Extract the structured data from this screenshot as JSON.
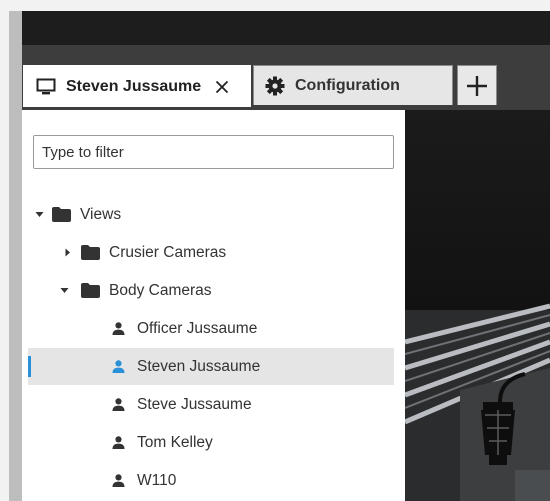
{
  "tabs": [
    {
      "label": "Steven Jussaume",
      "icon": "monitor-icon",
      "active": true,
      "closable": true
    },
    {
      "label": "Configuration",
      "icon": "gear-icon",
      "active": false
    }
  ],
  "add_tab_icon": "plus-icon",
  "filter": {
    "placeholder": "Type to filter",
    "value": ""
  },
  "tree": {
    "root": {
      "label": "Views",
      "expanded": true
    },
    "groups": [
      {
        "label": "Crusier Cameras",
        "expanded": false
      },
      {
        "label": "Body Cameras",
        "expanded": true
      }
    ],
    "cameras": [
      {
        "label": "Officer Jussaume",
        "selected": false
      },
      {
        "label": "Steven Jussaume",
        "selected": true
      },
      {
        "label": "Steve Jussaume",
        "selected": false
      },
      {
        "label": "Tom Kelley",
        "selected": false
      },
      {
        "label": "W110",
        "selected": false
      }
    ]
  },
  "colors": {
    "selection_accent": "#2a90d8",
    "tab_strip": "#3d3d3d",
    "top_bar": "#1d1d1d"
  }
}
